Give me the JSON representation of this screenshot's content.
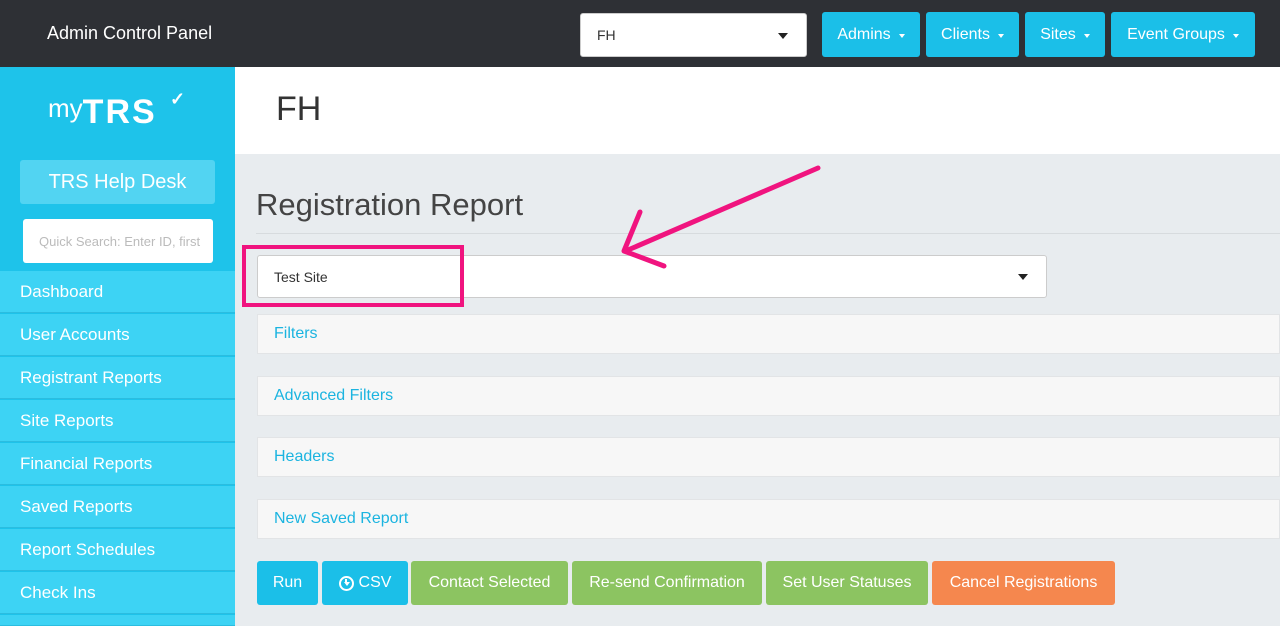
{
  "topbar": {
    "title": "Admin Control Panel",
    "client_select": {
      "value": "FH"
    },
    "nav": [
      {
        "label": "Admins"
      },
      {
        "label": "Clients"
      },
      {
        "label": "Sites"
      },
      {
        "label": "Event Groups"
      }
    ]
  },
  "sidebar": {
    "logo": {
      "my": "my",
      "brand": "TRS",
      "check": "✓"
    },
    "helpdesk_label": "TRS Help Desk",
    "search_placeholder": "Quick Search: Enter ID, first",
    "items": [
      {
        "label": "Dashboard"
      },
      {
        "label": "User Accounts"
      },
      {
        "label": "Registrant Reports"
      },
      {
        "label": "Site Reports"
      },
      {
        "label": "Financial Reports"
      },
      {
        "label": "Saved Reports"
      },
      {
        "label": "Report Schedules"
      },
      {
        "label": "Check Ins"
      }
    ]
  },
  "main": {
    "site_title": "FH",
    "report_title": "Registration Report",
    "site_select": {
      "value": "Test Site"
    },
    "sections": [
      {
        "label": "Filters"
      },
      {
        "label": "Advanced Filters"
      },
      {
        "label": "Headers"
      },
      {
        "label": "New Saved Report"
      }
    ],
    "actions": {
      "run": "Run",
      "csv": "CSV",
      "contact": "Contact Selected",
      "resend": "Re-send Confirmation",
      "set_status": "Set User Statuses",
      "cancel": "Cancel Registrations"
    }
  },
  "colors": {
    "topbar": "#2e3035",
    "accent": "#1bbfe8",
    "sidebar": "#1ec3ea",
    "green": "#8cc461",
    "orange": "#f5874e",
    "annotation": "#f0147f"
  }
}
